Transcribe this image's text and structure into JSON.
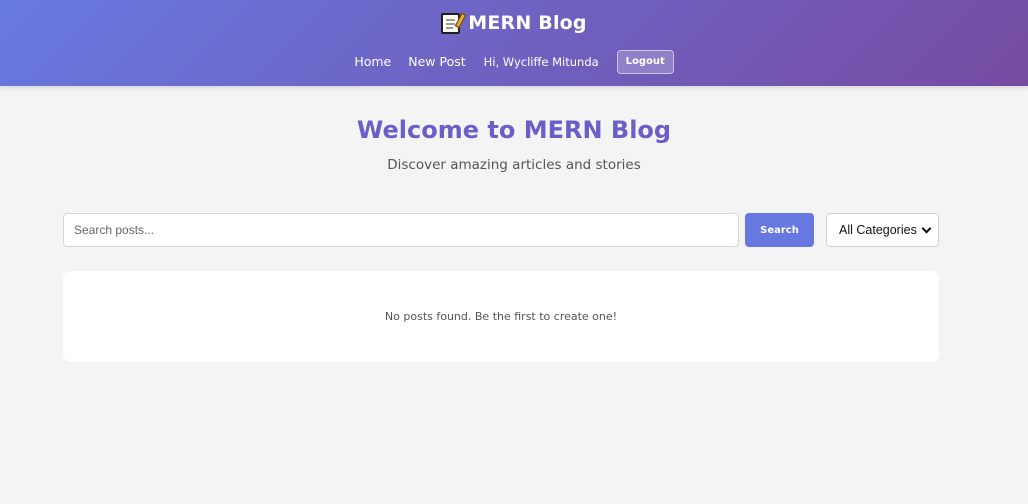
{
  "header": {
    "title": "MERN Blog",
    "icon": "memo-icon",
    "gradient": [
      "#6779e0",
      "#764ba2"
    ]
  },
  "nav": {
    "home": "Home",
    "new_post": "New Post",
    "greeting": "Hi, Wycliffe Mitunda",
    "logout": "Logout"
  },
  "hero": {
    "title": "Welcome to MERN Blog",
    "subtitle": "Discover amazing articles and stories",
    "title_color": "#6a5fc8"
  },
  "search": {
    "placeholder": "Search posts...",
    "value": "",
    "button_label": "Search",
    "category_selected": "All Categories",
    "accent": "#6779e0"
  },
  "posts": {
    "empty_message": "No posts found. Be the first to create one!"
  }
}
